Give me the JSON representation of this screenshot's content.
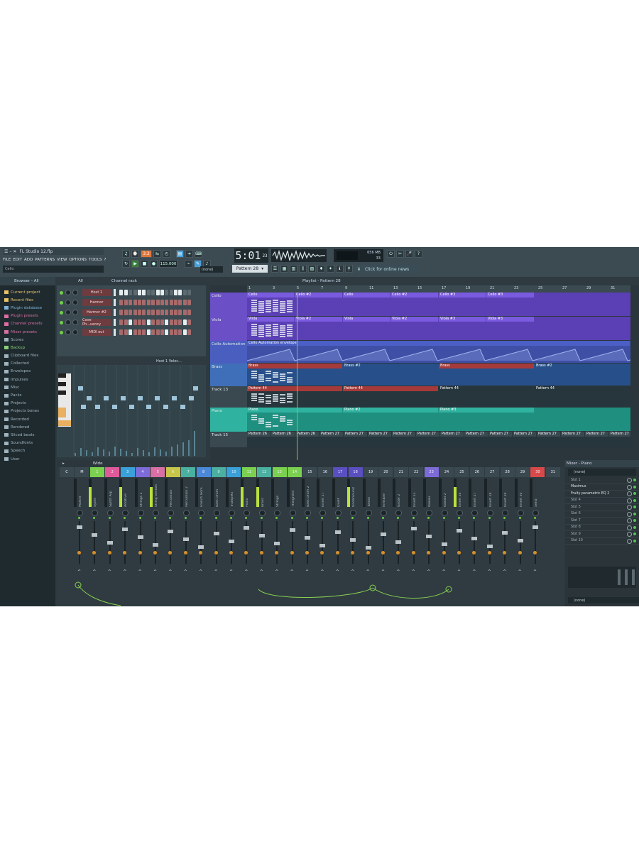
{
  "window": {
    "title": "FL Studio 12.flp",
    "hint": "Cello"
  },
  "menu": [
    "FILE",
    "EDIT",
    "ADD",
    "PATTERNS",
    "VIEW",
    "OPTIONS",
    "TOOLS",
    "?"
  ],
  "transport": {
    "song_position": "5:01",
    "song_ticks": "23",
    "tempo": "115.000",
    "mode_display": "3.2",
    "ram": "656 MB",
    "voices": "33"
  },
  "toolbar": {
    "pattern_name": "Pattern 28",
    "news_label": "Click for online news",
    "snap_label": "(none)"
  },
  "browser": {
    "title": "Browser - All",
    "items": [
      {
        "label": "Current project",
        "color": "#e8c36a"
      },
      {
        "label": "Recent files",
        "color": "#e8c36a"
      },
      {
        "label": "Plugin database",
        "color": "#7fb3d8"
      },
      {
        "label": "Plugin presets",
        "color": "#d86fa5"
      },
      {
        "label": "Channel presets",
        "color": "#d86fa5"
      },
      {
        "label": "Mixer presets",
        "color": "#d86fa5"
      },
      {
        "label": "Scores",
        "color": "#9fb4bd"
      },
      {
        "label": "Backup",
        "color": "#8ad07a"
      },
      {
        "label": "Clipboard files",
        "color": "#9fb4bd"
      },
      {
        "label": "Collected",
        "color": "#9fb4bd"
      },
      {
        "label": "Envelopes",
        "color": "#9fb4bd"
      },
      {
        "label": "Impulses",
        "color": "#9fb4bd"
      },
      {
        "label": "Misc",
        "color": "#9fb4bd"
      },
      {
        "label": "Packs",
        "color": "#9fb4bd"
      },
      {
        "label": "Projects",
        "color": "#9fb4bd"
      },
      {
        "label": "Projects bones",
        "color": "#9fb4bd"
      },
      {
        "label": "Recorded",
        "color": "#9fb4bd"
      },
      {
        "label": "Rendered",
        "color": "#9fb4bd"
      },
      {
        "label": "Sliced beats",
        "color": "#9fb4bd"
      },
      {
        "label": "Soundfonts",
        "color": "#9fb4bd"
      },
      {
        "label": "Speech",
        "color": "#9fb4bd"
      },
      {
        "label": "User",
        "color": "#9fb4bd"
      }
    ]
  },
  "channel_rack": {
    "title": "Channel rack",
    "filter": "All",
    "channels": [
      {
        "name": "Host 1"
      },
      {
        "name": "Harmor"
      },
      {
        "name": "Harmor #2"
      },
      {
        "name": "Cove Ph...uency"
      },
      {
        "name": "MIDI out"
      }
    ]
  },
  "piano_roll": {
    "title": "Host 1 Veloc..."
  },
  "playlist": {
    "title": "Playlist - Pattern 28",
    "bars": [
      "1",
      "3",
      "5",
      "7",
      "9",
      "11",
      "13",
      "15",
      "17",
      "19",
      "21",
      "23",
      "25",
      "27",
      "29",
      "31"
    ],
    "tracks": [
      {
        "name": "Cello",
        "color": "#6b4fc7"
      },
      {
        "name": "Viola",
        "color": "#6b4fc7"
      },
      {
        "name": "Cello Automation",
        "color": "#4a5ec0"
      },
      {
        "name": "Brass",
        "color": "#3f6fb8"
      },
      {
        "name": "Track 13",
        "color": "#3a4850"
      },
      {
        "name": "Piano",
        "color": "#2fb3a0"
      },
      {
        "name": "Track 15",
        "color": "#3a4850"
      }
    ],
    "clips": {
      "cello": [
        "Cello",
        "Cello #2",
        "Cello",
        "Cello #2",
        "Cello #3",
        "Cello #3"
      ],
      "viola": [
        "Viola",
        "Viola #2",
        "Viola",
        "Viola #2",
        "Viola #3",
        "Viola #3"
      ],
      "automation": [
        "Cello Automation envelope"
      ],
      "brass": [
        "Brass",
        "Brass #2",
        "Brass",
        "Brass #2"
      ],
      "track13": [
        "Pattern 44",
        "Pattern 44",
        "Pattern 44",
        "Pattern 44"
      ],
      "piano": [
        "Piano",
        "Piano #2",
        "Piano #3"
      ],
      "track15": [
        "Pattern 26",
        "Pattern 26",
        "Pattern 26",
        "Pattern 27",
        "Pattern 27",
        "Pattern 27",
        "Pattern 27",
        "Pattern 27",
        "Pattern 27",
        "Pattern 27",
        "Pattern 27",
        "Pattern 27",
        "Pattern 27",
        "Pattern 27",
        "Pattern 27",
        "Pattern 27"
      ]
    }
  },
  "mixer": {
    "title": "Wide",
    "strips": [
      "Master",
      "Synth",
      "Synth Arp",
      "Additive",
      "Strings 2",
      "String Section",
      "Percussion",
      "Percussion 2",
      "French Horn",
      "Bass Drum",
      "Trumpets",
      "Piano",
      "Brass",
      "Strings",
      "Thingness",
      "Bass Drum 2",
      "Insert 17",
      "Quiet",
      "Undersound",
      "Totoro",
      "Invisible",
      "Under 2",
      "Insert 23",
      "Kawaii",
      "Kawaii 2",
      "Insert 26",
      "Insert 27",
      "Insert 28",
      "Insert 29",
      "Insert 30",
      "Send"
    ],
    "numbers": [
      "C",
      "M",
      "1",
      "2",
      "3",
      "4",
      "5",
      "6",
      "7",
      "8",
      "9",
      "10",
      "11",
      "12",
      "13",
      "14",
      "15",
      "16",
      "17",
      "18",
      "19",
      "20",
      "21",
      "22",
      "23",
      "24",
      "25",
      "26",
      "27",
      "28",
      "29",
      "30",
      "31"
    ]
  },
  "mixer_panel": {
    "title": "Mixer - Piano",
    "input": "(none)",
    "output": "(none)",
    "slots": [
      "Slot 1",
      "Maximus",
      "Fruity parametric EQ 2",
      "Slot 4",
      "Slot 5",
      "Slot 6",
      "Slot 7",
      "Slot 8",
      "Slot 9",
      "Slot 10"
    ]
  }
}
